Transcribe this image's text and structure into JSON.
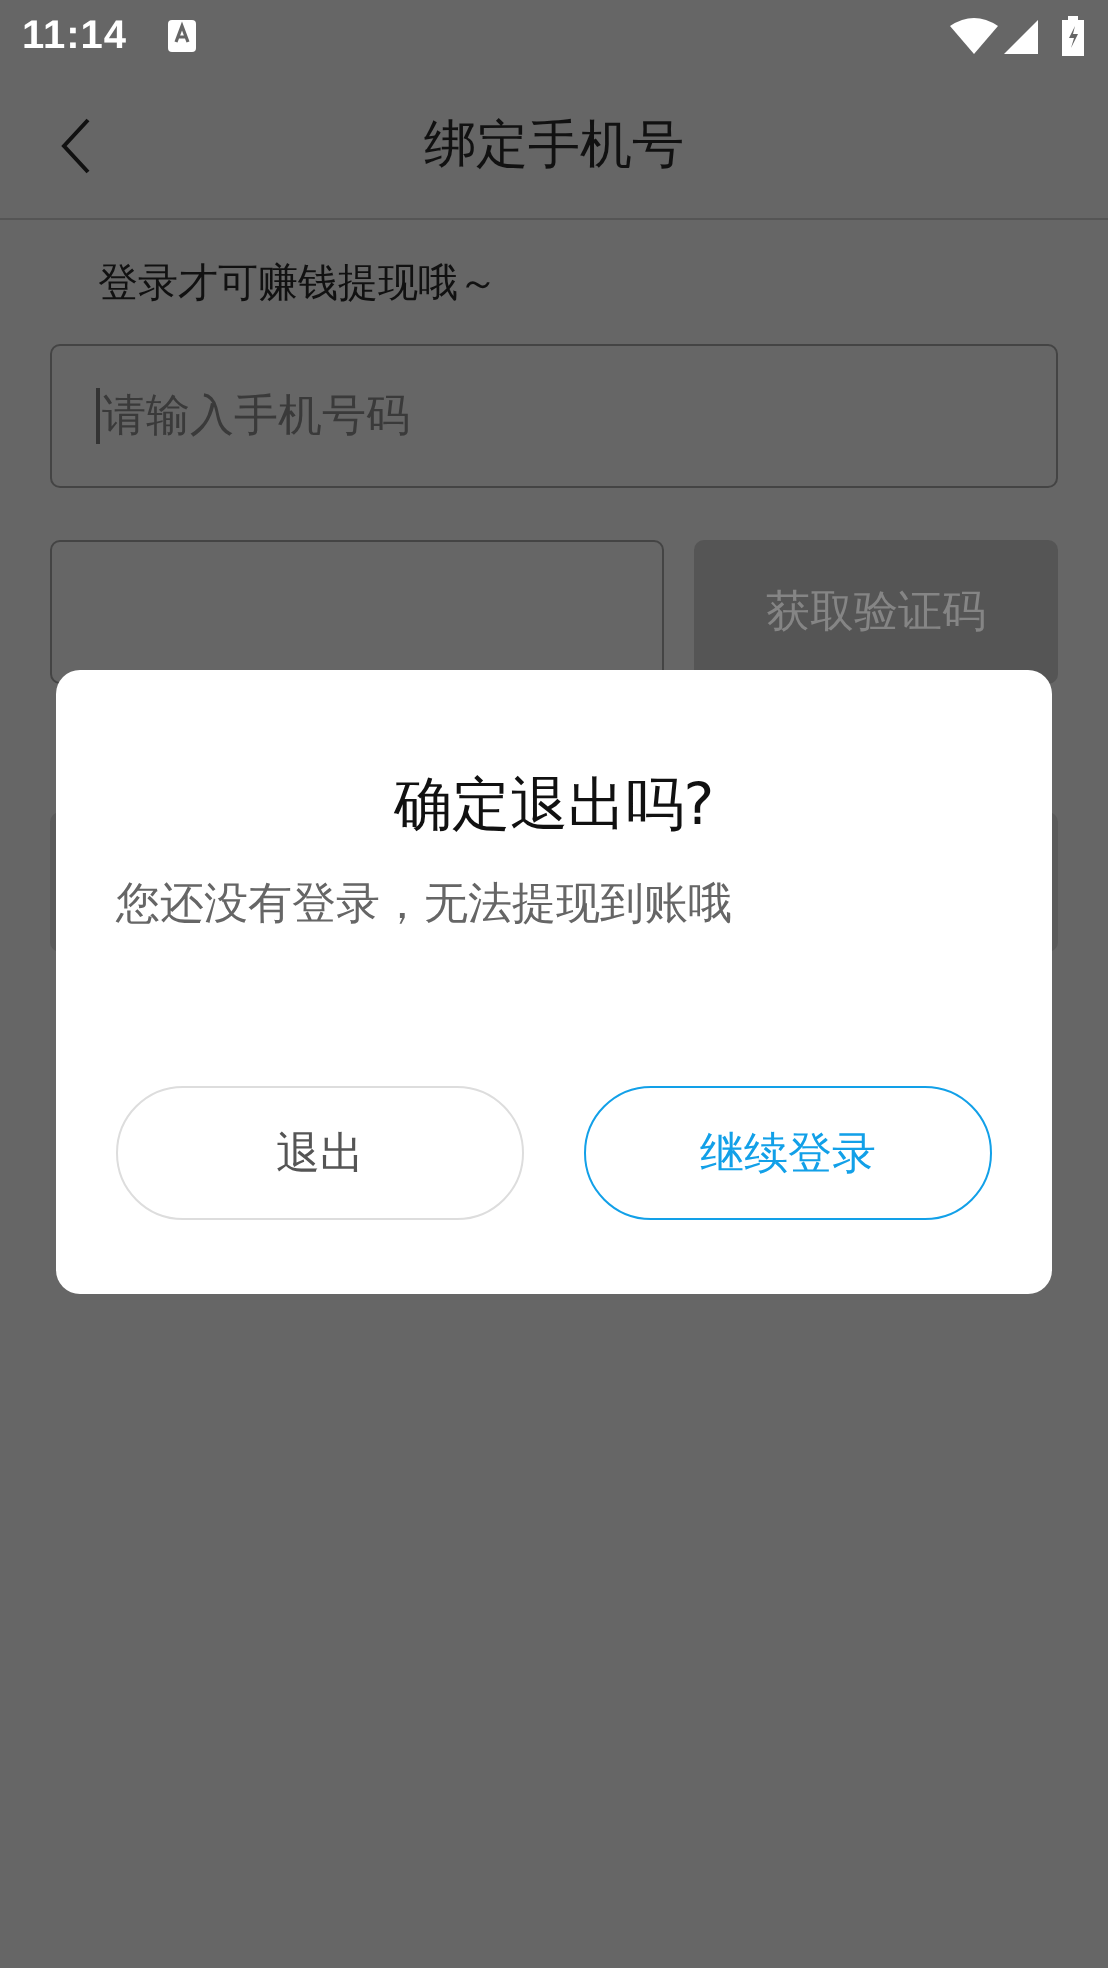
{
  "status_bar": {
    "time": "11:14"
  },
  "header": {
    "title": "绑定手机号"
  },
  "form": {
    "hint": "登录才可赚钱提现哦～",
    "phone_field": {
      "placeholder": "请输入手机号码",
      "focused": true
    },
    "code_field": {
      "focused": false
    },
    "code_button": {
      "label": "获取验证码",
      "disabled": true
    }
  },
  "dialog": {
    "title": "确定退出吗?",
    "message": "您还没有登录，无法提现到账哦",
    "buttons": [
      {
        "label": "退出",
        "kind": "secondary"
      },
      {
        "label": "继续登录",
        "kind": "primary"
      }
    ]
  }
}
